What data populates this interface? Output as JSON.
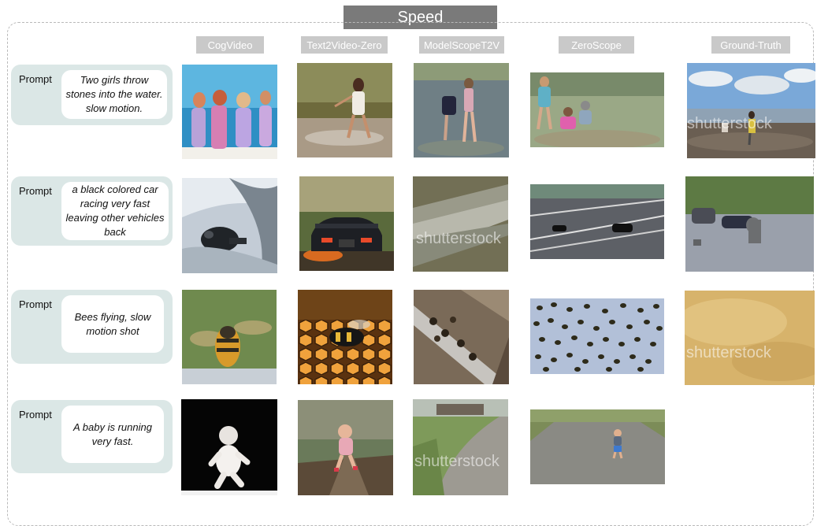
{
  "title": "Speed",
  "columns": [
    "CogVideo",
    "Text2Video-Zero",
    "ModelScopeT2V",
    "ZeroScope",
    "Ground-Truth"
  ],
  "rows": [
    {
      "label": "Prompt",
      "text": "Two girls throw stones into the water. slow motion."
    },
    {
      "label": "Prompt",
      "text": "a black colored car racing very fast leaving other vehicles back"
    },
    {
      "label": "Prompt",
      "text": "Bees flying, slow motion shot"
    },
    {
      "label": "Prompt",
      "text": "A baby is running very fast."
    }
  ],
  "watermark": "shutterstock"
}
